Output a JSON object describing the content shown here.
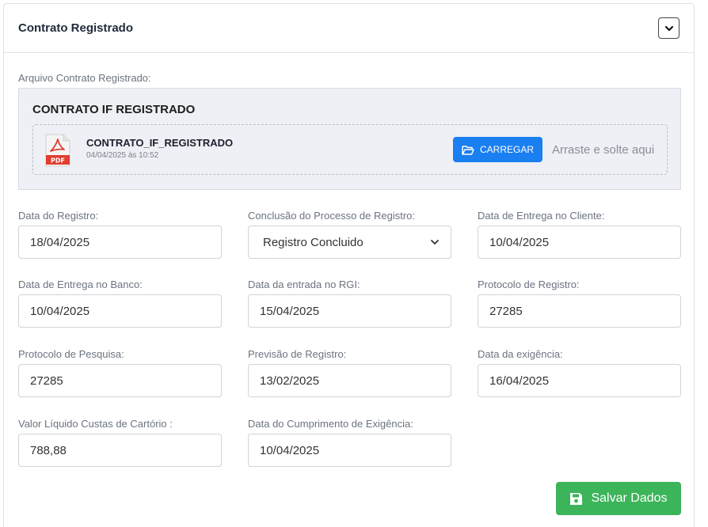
{
  "card": {
    "title": "Contrato Registrado"
  },
  "upload": {
    "section_label": "Arquivo Contrato Registrado:",
    "box_title": "CONTRATO IF REGISTRADO",
    "file_name": "CONTRATO_IF_REGISTRADO",
    "file_date": "04/04/2025 às 10:52",
    "file_type": "PDF",
    "upload_button": "CARREGAR",
    "drop_hint": "Arraste e solte aqui"
  },
  "fields": {
    "data_registro": {
      "label": "Data do Registro:",
      "value": "18/04/2025"
    },
    "conclusao": {
      "label": "Conclusão do Processo de Registro:",
      "value": "Registro Concluido"
    },
    "entrega_cliente": {
      "label": "Data de Entrega no Cliente:",
      "value": "10/04/2025"
    },
    "entrega_banco": {
      "label": "Data de Entrega no Banco:",
      "value": "10/04/2025"
    },
    "entrada_rgi": {
      "label": "Data da entrada no RGI:",
      "value": "15/04/2025"
    },
    "protocolo_registro": {
      "label": "Protocolo de Registro:",
      "value": "27285"
    },
    "protocolo_pesquisa": {
      "label": "Protocolo de Pesquisa:",
      "value": "27285"
    },
    "previsao_registro": {
      "label": "Previsão de Registro:",
      "value": "13/02/2025"
    },
    "data_exigencia": {
      "label": "Data da exigência:",
      "value": "16/04/2025"
    },
    "valor_custas": {
      "label": "Valor Líquido Custas de Cartório :",
      "value": "788,88"
    },
    "cumprimento_exigencia": {
      "label": "Data do Cumprimento de Exigência:",
      "value": "10/04/2025"
    }
  },
  "actions": {
    "save_label": "Salvar Dados"
  },
  "colors": {
    "primary": "#1a7ff0",
    "success": "#3cb45a",
    "pdf_red": "#e03e2f"
  },
  "icons": {
    "collapse": "chevron-down-icon",
    "pdf": "pdf-file-icon",
    "upload": "folder-open-icon",
    "save": "floppy-disk-icon"
  }
}
